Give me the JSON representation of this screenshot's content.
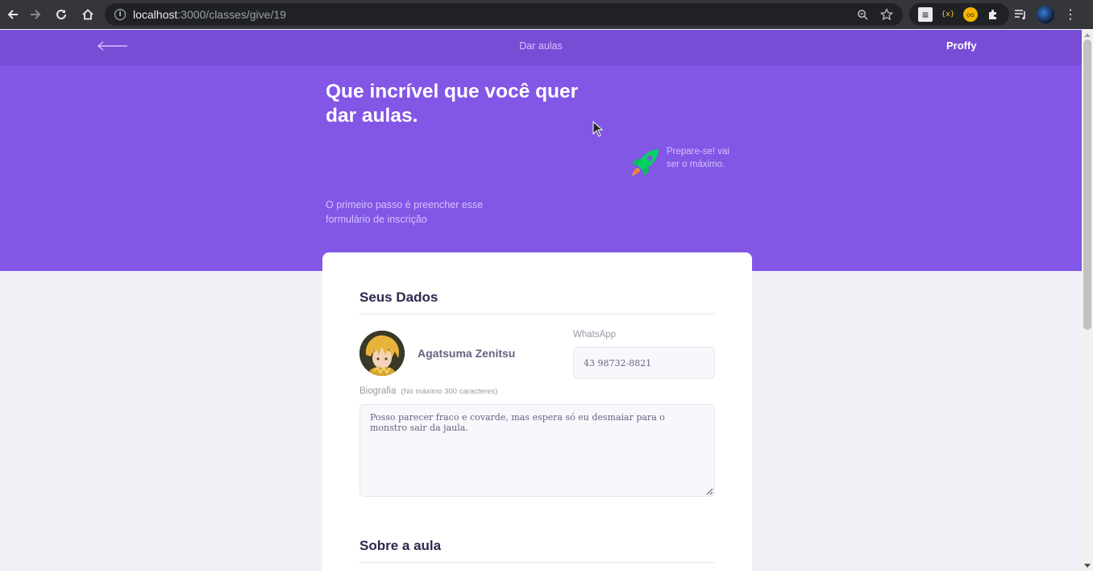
{
  "browser": {
    "url_host": "localhost",
    "url_path": ":3000/classes/give/19",
    "back_icon": "arrow-left-icon",
    "forward_icon": "arrow-right-icon",
    "reload_icon": "reload-icon",
    "home_icon": "home-icon"
  },
  "header": {
    "title": "Dar aulas",
    "logo": "Proffy"
  },
  "hero": {
    "title": "Que incrível que você quer dar aulas.",
    "description": "O primeiro passo é preencher esse formulário de inscrição",
    "tip": "Prepare-se! vai ser o máximo."
  },
  "form": {
    "section_personal": "Seus Dados",
    "user_name": "Agatsuma Zenitsu",
    "whatsapp_label": "WhatsApp",
    "whatsapp_value": "43 98732-8821",
    "bio_label": "Biografia",
    "bio_hint": "(No máximo 300 caracteres)",
    "bio_value": "Posso parecer fraco e covarde, mas espera só eu desmaiar para o monstro sair da jaula.",
    "section_class": "Sobre a aula"
  },
  "colors": {
    "primary": "#8257e5",
    "primary_dark": "#774dd6",
    "background": "#f0f0f7",
    "title_text": "#32264d"
  }
}
